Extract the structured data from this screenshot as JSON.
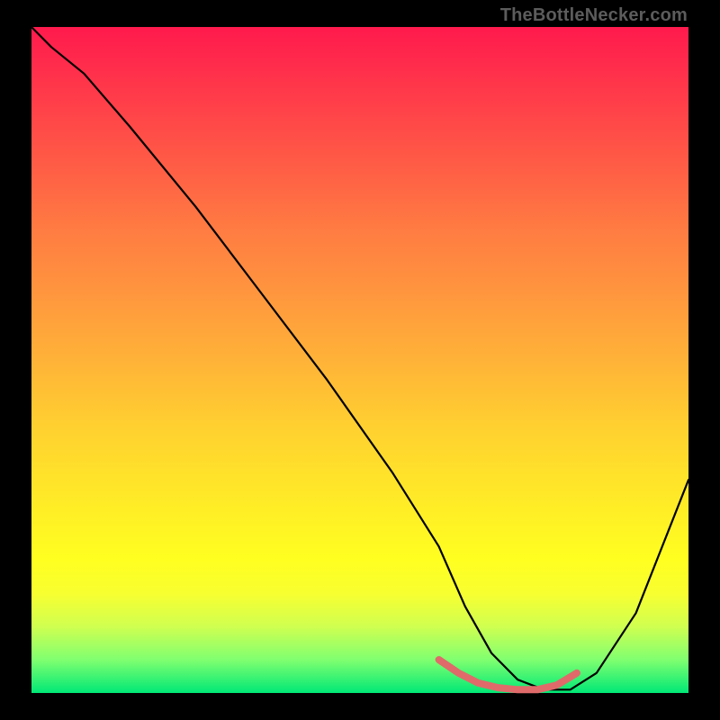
{
  "watermark": "TheBottleNecker.com",
  "chart_data": {
    "type": "line",
    "title": "",
    "xlabel": "",
    "ylabel": "",
    "xlim": [
      0,
      100
    ],
    "ylim": [
      0,
      100
    ],
    "grid": false,
    "series": [
      {
        "name": "bottleneck-curve",
        "color": "#000000",
        "x": [
          0,
          3,
          8,
          15,
          25,
          35,
          45,
          55,
          62,
          66,
          70,
          74,
          78,
          82,
          86,
          92,
          100
        ],
        "y": [
          100,
          97,
          93,
          85,
          73,
          60,
          47,
          33,
          22,
          13,
          6,
          2,
          0.5,
          0.5,
          3,
          12,
          32
        ]
      }
    ],
    "highlight": {
      "name": "optimal-range",
      "color": "#e06a6a",
      "x": [
        62,
        65,
        68,
        71,
        74,
        77,
        80,
        83
      ],
      "y": [
        5,
        3,
        1.5,
        0.8,
        0.5,
        0.5,
        1.2,
        3
      ]
    }
  }
}
